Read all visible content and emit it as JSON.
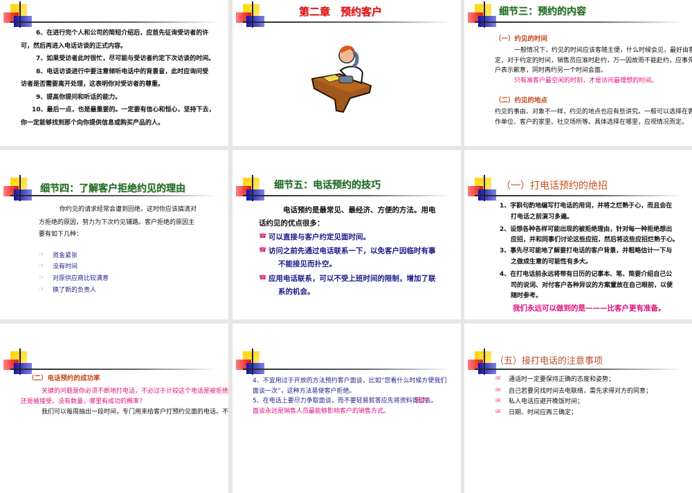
{
  "slides": [
    {
      "lines": [
        "6、在进行完个人和公司的简短介绍后，应首先征询受访者的许",
        "可，然后再进入电话访谈的正式内容。",
        "7、如果受访者此时很忙，尽可能与受访者约定下次访谈的时间。",
        "8、电话访谈进行中要注意倾听电话中的背景音，此时应询问受",
        "访者是否需要离开处理，这表明你对受访者的尊重。",
        "9、提高你提问和听话的能力。",
        "10、最后一点，也是最重要的。一定要有信心和恒心，坚持下去，",
        "你一定能够找到那个向你提供信息或购买产品的人。"
      ]
    },
    {
      "title": "第二章　预约客户",
      "image": "man-on-phone-at-desk-clipart"
    },
    {
      "title": "细节三：预约的内容",
      "section1": "（一）约见的时间",
      "body1": [
        "一般情况下，约见的时间应该客随主便，什么时候会见，最好由客户决",
        "定，对于约定的时间，销售员应准时赴约，万一因故而不能赴约，应事先向客",
        "户表示歉意，同时再约另一个时间会面。"
      ],
      "highlight": "只有准客户最空闲的时刻，才是访问最理想的时间。",
      "section2": "（二）约见的地点",
      "body2": [
        "约见的事由、对象不一样，约见的地点也应有些讲究。一般可以选择在客户工",
        "作单位、客户的家里、社交场所等。具体选择在哪里，应视情况而定。"
      ]
    },
    {
      "title": "细节四：了解客户拒绝约见的理由",
      "body": [
        "你约见的请求经常会遭到回绝，这时你应该搞清对",
        "方拒绝的原因，努力为下次约见铺路。客户拒绝的原因主",
        "要有如下几种："
      ],
      "bullets": [
        "资金紧张",
        "没有时间",
        "对原供应商比较满意",
        "换了新的负责人"
      ]
    },
    {
      "title": "细节五：电话预约的技巧",
      "body": [
        "电话预约是最常见、最经济、方便的方法。用电",
        "话约见的优点很多："
      ],
      "items": [
        "可以直接与客户约定见面时间。",
        "访问之前先通过电话联系一下，以免客户因临时有事",
        "不能接见而扑空。",
        "应用电话联系，可以不受上班时间的限制，增加了联",
        "系的机会。"
      ]
    },
    {
      "title": "（一）打电话预约的绝招",
      "lines": [
        "1、字斟句酌地编写打电话的用词，并将之烂熟于心，而且会在",
        "打电话之前演习多遍。",
        "2、设想各种各样可能出现的被拒绝理由，针对每一种拒绝想出",
        "应招，并和同事们讨论这些应招，然后将这些应招烂熟于心。",
        "3、事先尽可能地了解要打电话的客户背景，并粗略估计一下与",
        "之做成生意的可能性有多大。",
        "4、在打电话前永远将带有日历的记事本、笔、简要介绍自己公",
        "司的说词、对付客户各种异议的方案置放在自己眼前，以便",
        "随时参考。"
      ],
      "highlight": "我们永远可以做到的是———比客户更有准备。"
    },
    {
      "section": "（二）电话预约的成功率",
      "highlight": [
        "关键的问题是你必须不断地打电话，不必过于计较这个电话是被拒绝",
        "还是被接受。没有数量，哪里有成功的概率？"
      ],
      "body": [
        "我们可以每周抽出一段时间，专门用来给客户打预约见面的电话。不"
      ]
    },
    {
      "lines": [
        "4、不宜用过于开放的方法预约客户面谈，比如“您看什么时候方便我们",
        "面谈一次”，这种方法易使客户拒绝。",
        "5、在电话上要尽力争取面谈，而不要轻易就答应先将资料寄过去。"
      ],
      "highlight": [
        "因为",
        "面谈永远是销售人员最能够影响客户的销售方式。"
      ]
    },
    {
      "title": "（五）接打电话的注意事项",
      "bullets": [
        "通话时一定要保持正确的态度和姿势；",
        "自己若要另找时间去电联络，需先求得对方的同意；",
        "私人电话应避开晚饭时间；",
        "日期、时间应再三确定；"
      ]
    }
  ]
}
